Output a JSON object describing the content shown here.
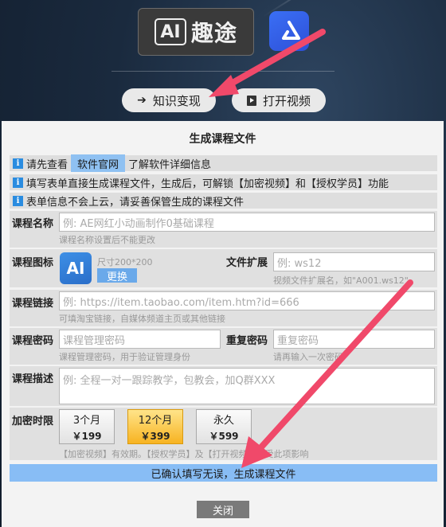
{
  "header": {
    "logo_ai_mark": "AI",
    "logo_brand": "趣途",
    "btn_knowledge": "知识变现",
    "btn_video": "打开视频"
  },
  "dialog": {
    "title": "生成课程文件",
    "info1_prefix": "请先查看",
    "info1_link": "软件官网",
    "info1_suffix": "了解软件详细信息",
    "info2": "填写表单直接生成课程文件，生成后，可解锁【加密视频】和【授权学员】功能",
    "info3": "表单信息不会上云，请妥善保管生成的课程文件",
    "course_name": {
      "label": "课程名称",
      "placeholder": "例: AE网红小动画制作0基础课程",
      "hint": "课程名称设置后不能更改"
    },
    "course_icon": {
      "label": "课程图标",
      "icon_text": "AI",
      "size_hint": "尺寸200*200",
      "swap": "更换"
    },
    "file_ext": {
      "label": "文件扩展",
      "placeholder": "例: ws12",
      "hint": "视频文件扩展名，如\"A001.ws12\""
    },
    "course_link": {
      "label": "课程链接",
      "placeholder": "例: https://item.taobao.com/item.htm?id=666",
      "hint": "可填淘宝链接，自媒体频道主页或其他链接"
    },
    "course_pwd": {
      "label": "课程密码",
      "placeholder": "课程管理密码",
      "hint": "课程管理密码，用于验证管理身份"
    },
    "repeat_pwd": {
      "label": "重复密码",
      "placeholder": "重复密码",
      "hint": "请再输入一次密码"
    },
    "course_desc": {
      "label": "课程描述",
      "placeholder": "例: 全程一对一跟踪教学，包教会，加Q群XXX"
    },
    "period": {
      "label": "加密时限",
      "options": [
        {
          "name": "3个月",
          "price": "￥199"
        },
        {
          "name": "12个月",
          "price": "￥399"
        },
        {
          "name": "永久",
          "price": "￥599"
        }
      ],
      "hint": "【加密视频】有效期。【授权学员】及【打开视频】不受此项影响"
    },
    "submit": "已确认填写无误，生成课程文件",
    "close": "关闭"
  },
  "colors": {
    "accent_blue": "#88bdf5",
    "active_period": "#f7b321",
    "arrow": "#f0496a"
  }
}
